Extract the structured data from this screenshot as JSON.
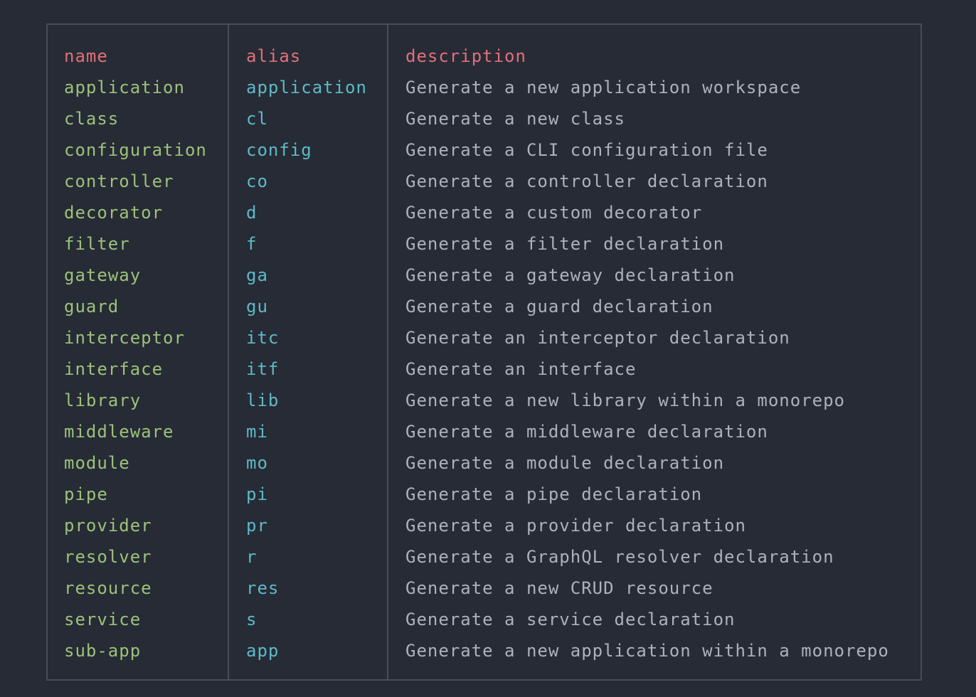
{
  "header": {
    "name": "name",
    "alias": "alias",
    "description": "description"
  },
  "rows": [
    {
      "name": "application",
      "alias": "application",
      "description": "Generate a new application workspace"
    },
    {
      "name": "class",
      "alias": "cl",
      "description": "Generate a new class"
    },
    {
      "name": "configuration",
      "alias": "config",
      "description": "Generate a CLI configuration file"
    },
    {
      "name": "controller",
      "alias": "co",
      "description": "Generate a controller declaration"
    },
    {
      "name": "decorator",
      "alias": "d",
      "description": "Generate a custom decorator"
    },
    {
      "name": "filter",
      "alias": "f",
      "description": "Generate a filter declaration"
    },
    {
      "name": "gateway",
      "alias": "ga",
      "description": "Generate a gateway declaration"
    },
    {
      "name": "guard",
      "alias": "gu",
      "description": "Generate a guard declaration"
    },
    {
      "name": "interceptor",
      "alias": "itc",
      "description": "Generate an interceptor declaration"
    },
    {
      "name": "interface",
      "alias": "itf",
      "description": "Generate an interface"
    },
    {
      "name": "library",
      "alias": "lib",
      "description": "Generate a new library within a monorepo"
    },
    {
      "name": "middleware",
      "alias": "mi",
      "description": "Generate a middleware declaration"
    },
    {
      "name": "module",
      "alias": "mo",
      "description": "Generate a module declaration"
    },
    {
      "name": "pipe",
      "alias": "pi",
      "description": "Generate a pipe declaration"
    },
    {
      "name": "provider",
      "alias": "pr",
      "description": "Generate a provider declaration"
    },
    {
      "name": "resolver",
      "alias": "r",
      "description": "Generate a GraphQL resolver declaration"
    },
    {
      "name": "resource",
      "alias": "res",
      "description": "Generate a new CRUD resource"
    },
    {
      "name": "service",
      "alias": "s",
      "description": "Generate a service declaration"
    },
    {
      "name": "sub-app",
      "alias": "app",
      "description": "Generate a new application within a monorepo"
    }
  ],
  "colors": {
    "background": "#272b35",
    "border": "#474c56",
    "header": "#e0707a",
    "name": "#9cc27a",
    "alias": "#5cbac9",
    "description": "#acb2bd"
  }
}
